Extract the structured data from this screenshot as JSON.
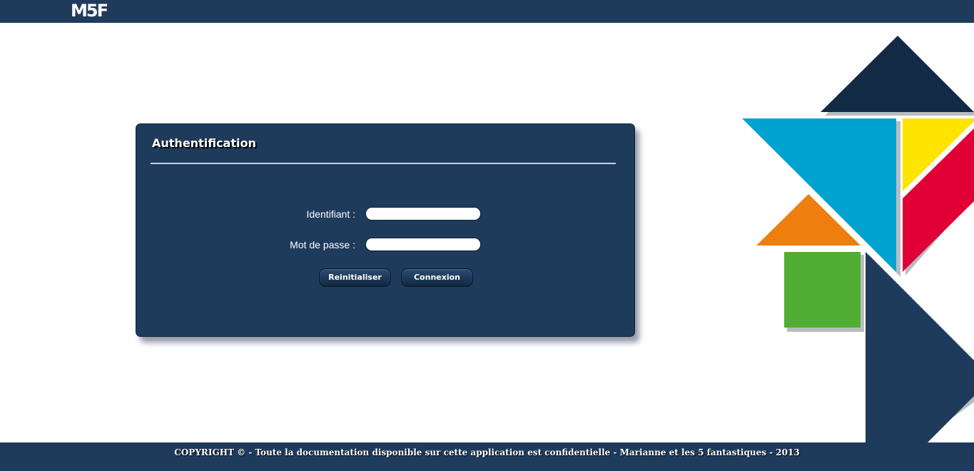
{
  "header": {
    "logo_text": "M5F",
    "color": "#1f3b5c"
  },
  "login": {
    "title": "Authentification",
    "username_label": "Identifiant :",
    "username_value": "",
    "password_label": "Mot de passe :",
    "password_value": "",
    "reset_label": "Reinitialiser",
    "submit_label": "Connexion"
  },
  "footer": {
    "text": "COPYRIGHT © - Toute la documentation disponible sur cette application est confidentielle - Marianne et les 5 fantastiques - 2013"
  },
  "decoration": {
    "name": "tangram-illustration",
    "colors": {
      "navy": "#132a45",
      "blue": "#1f3b5c",
      "cyan": "#00a2cf",
      "yellow": "#ffe400",
      "red": "#e10036",
      "orange": "#ee7f0f",
      "green": "#52ae32"
    }
  }
}
